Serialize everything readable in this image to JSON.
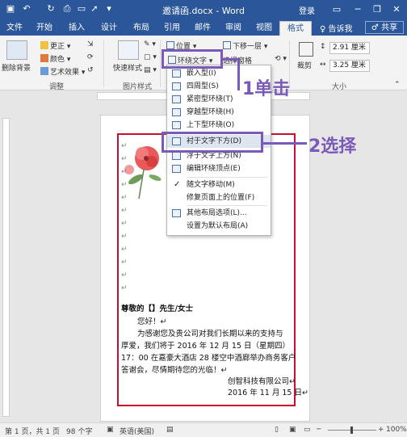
{
  "titlebar": {
    "title": "邀请函.docx - Word",
    "login": "登录",
    "minimize": "─",
    "restore": "❐",
    "close": "✕"
  },
  "tabs": [
    "文件",
    "开始",
    "插入",
    "设计",
    "布局",
    "引用",
    "邮件",
    "审阅",
    "视图",
    "格式"
  ],
  "active_tab": "格式",
  "tell_me": "♀ 告诉我",
  "share": "♂ 共享",
  "ribbon": {
    "remove_bg": "删除背景",
    "correct": "更正",
    "color": "颜色",
    "art_effect": "艺术效果",
    "adjust_group": "调整",
    "quick_style": "快速样式",
    "pic_style_group": "图片样式",
    "position": "位置",
    "wrap_text": "环绕文字",
    "bring_forward": "下移一层",
    "select_pane": "选择窗格",
    "crop": "裁剪",
    "size_group": "大小",
    "height": "2.91 厘米",
    "width": "3.25 厘米"
  },
  "menu": {
    "items": [
      "嵌入型(I)",
      "四周型(S)",
      "紧密型环绕(T)",
      "穿越型环绕(H)",
      "上下型环绕(O)",
      "衬于文字下方(D)",
      "浮于文字上方(N)",
      "编辑环绕顶点(E)",
      "随文字移动(M)",
      "修复页面上的位置(F)",
      "其他布局选项(L)...",
      "设置为默认布局(A)"
    ],
    "checked_item": "随文字移动(M)"
  },
  "annotations": {
    "step1": "1单击",
    "step2": "2选择"
  },
  "letter": {
    "greeting": "尊敬的【】先生/女士",
    "hello": "您好！↵",
    "body1": "为感谢您及贵公司对我们长期以来的支持与",
    "body2": "厚爱，我们将于 2016 年 12 月 15 日（星期四）",
    "body3": "17：00 在嘉豪大酒店 28 楼空中酒廊举办商务客户",
    "body4": "答谢会，尽情期待您的光临！↵",
    "sign": "创智科技有限公司↵",
    "date": "2016 年 11 月 15 日↵",
    "para_mark": "↵"
  },
  "status": {
    "page": "第 1 页，共 1 页",
    "words": "98 个字",
    "lang": "英语(美国)",
    "zoom": "100%"
  },
  "colors": {
    "word_blue": "#2b579a",
    "highlight": "#7a5ab8",
    "frame_red": "#c8102e"
  }
}
